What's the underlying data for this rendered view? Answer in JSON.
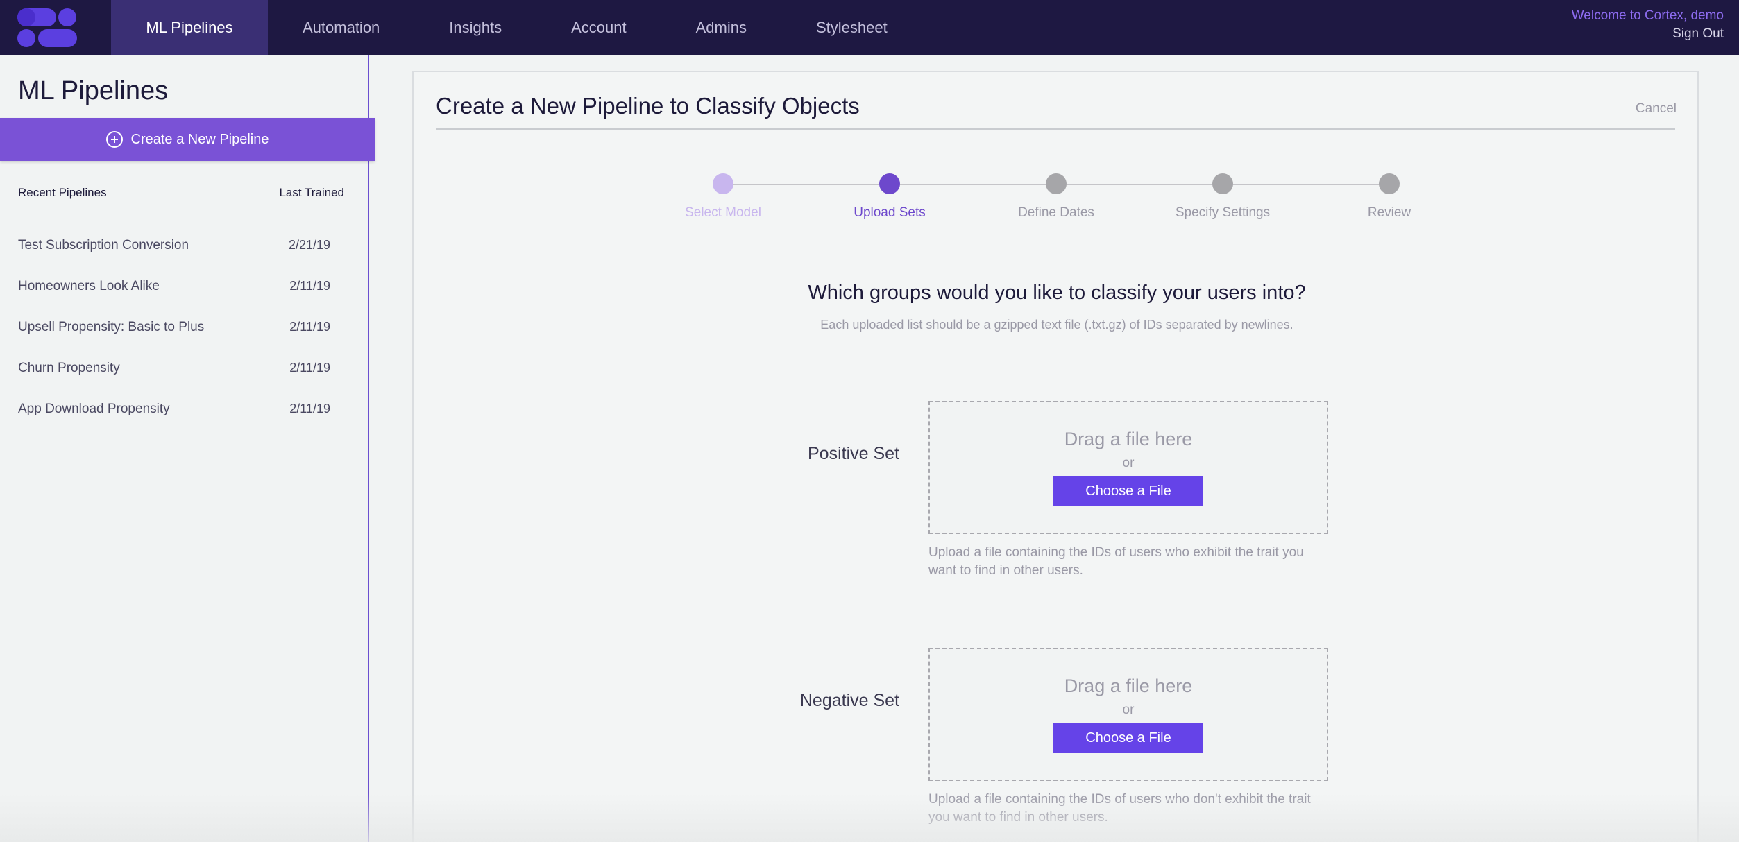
{
  "nav": {
    "items": [
      "ML Pipelines",
      "Automation",
      "Insights",
      "Account",
      "Admins",
      "Stylesheet"
    ],
    "welcome": "Welcome to Cortex, demo",
    "sign_out": "Sign Out"
  },
  "sidebar": {
    "title": "ML Pipelines",
    "create_label": "Create a New Pipeline",
    "col_recent": "Recent Pipelines",
    "col_trained": "Last Trained",
    "pipelines": [
      {
        "name": "Test Subscription Conversion",
        "date": "2/21/19"
      },
      {
        "name": "Homeowners Look Alike",
        "date": "2/11/19"
      },
      {
        "name": "Upsell Propensity: Basic to Plus",
        "date": "2/11/19"
      },
      {
        "name": "Churn Propensity",
        "date": "2/11/19"
      },
      {
        "name": "App Download Propensity",
        "date": "2/11/19"
      }
    ]
  },
  "main": {
    "title": "Create a New Pipeline to Classify Objects",
    "cancel": "Cancel",
    "steps": [
      "Select Model",
      "Upload Sets",
      "Define Dates",
      "Specify Settings",
      "Review"
    ],
    "question": "Which groups would you like to classify your users into?",
    "hint": "Each uploaded list should be a gzipped text file (.txt.gz) of IDs separated by newlines.",
    "positive": {
      "label": "Positive Set",
      "drag": "Drag a file here",
      "or": "or",
      "button": "Choose a File",
      "help": "Upload a file containing the IDs of users who exhibit the trait you want to find in other users."
    },
    "negative": {
      "label": "Negative Set",
      "drag": "Drag a file here",
      "or": "or",
      "button": "Choose a File",
      "help": "Upload a file containing the IDs of users who don't exhibit the trait you want to find in other users."
    }
  },
  "colors": {
    "nav_bg": "#1e1842",
    "accent": "#6543e8",
    "sidebar_button": "#7a52d6"
  }
}
